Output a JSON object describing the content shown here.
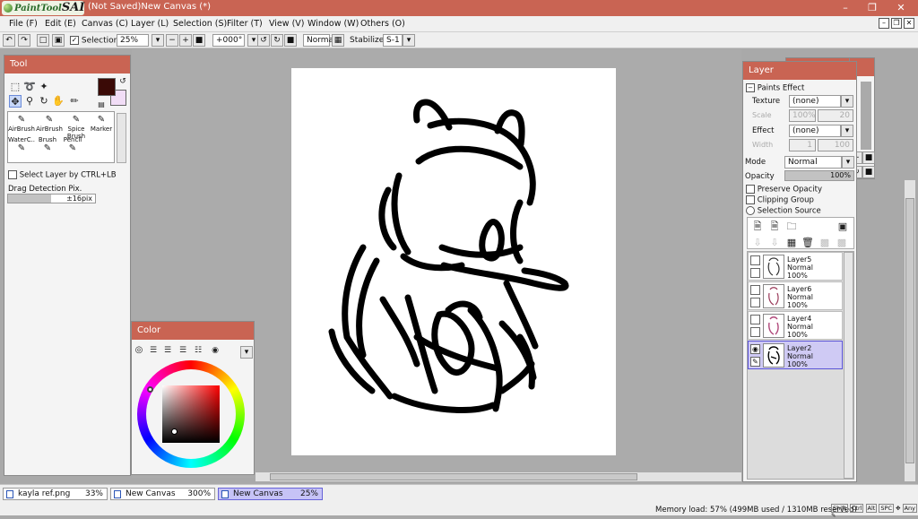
{
  "app": {
    "logo_text": "PaintTool",
    "logo_bold": "SAI",
    "window_title": "(Not Saved)New Canvas (*)"
  },
  "menu": [
    "File (F)",
    "Edit (E)",
    "Canvas (C)",
    "Layer (L)",
    "Selection (S)",
    "Filter (T)",
    "View (V)",
    "Window (W)",
    "Others (O)"
  ],
  "toolbar": {
    "selection_label": "Selection",
    "zoom": "25%",
    "rotation": "+000°",
    "blend": "Normal",
    "stabilizer_label": "Stabilizer",
    "stabilizer_value": "S-1"
  },
  "tool_panel": {
    "title": "Tool",
    "primary_color": "#3a0a06",
    "secondary_color": "#f1ddf6",
    "brushes_row1": [
      "AirBrush",
      "AirBrush",
      "Spice Brush",
      "Marker"
    ],
    "brushes_row2": [
      "WaterC..",
      "Brush",
      "Pencil"
    ],
    "select_layer_label": "Select Layer by CTRL+LB",
    "drag_detection_label": "Drag Detection Pix.",
    "drag_detection_value": "±16pix"
  },
  "color_panel": {
    "title": "Color"
  },
  "layer_panel": {
    "title": "Layer",
    "paints_effect": "Paints Effect",
    "texture_label": "Texture",
    "texture_value": "(none)",
    "scale_label": "Scale",
    "scale_value": "100%",
    "scale_value2": "20",
    "effect_label": "Effect",
    "effect_value": "(none)",
    "width_label": "Width",
    "width_value": "1",
    "width_value2": "100",
    "mode_label": "Mode",
    "mode_value": "Normal",
    "opacity_label": "Opacity",
    "opacity_value": "100%",
    "preserve_opacity": "Preserve Opacity",
    "clipping_group": "Clipping Group",
    "selection_source": "Selection Source",
    "layers": [
      {
        "name": "Layer5",
        "mode": "Normal",
        "opacity": "100%"
      },
      {
        "name": "Layer6",
        "mode": "Normal",
        "opacity": "100%"
      },
      {
        "name": "Layer4",
        "mode": "Normal",
        "opacity": "100%"
      },
      {
        "name": "Layer2",
        "mode": "Normal",
        "opacity": "100%"
      }
    ]
  },
  "documents": [
    {
      "name": "kayla ref.png",
      "zoom": "33%"
    },
    {
      "name": "New Canvas",
      "zoom": "300%"
    },
    {
      "name": "New Canvas",
      "zoom": "25%"
    }
  ],
  "status": {
    "memory": "Memory load: 57% (499MB used / 1310MB reserved)",
    "keys": [
      "Shift",
      "Ctrl",
      "Alt",
      "SPC",
      "Any"
    ]
  }
}
